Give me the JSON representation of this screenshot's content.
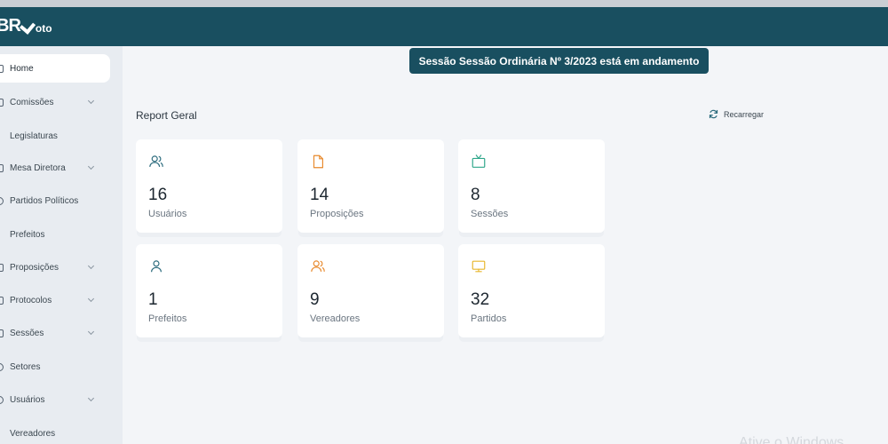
{
  "app": {
    "logo_main": "BR",
    "logo_suffix": "oto"
  },
  "banner": {
    "text": "Sessão Sessão Ordinária Nº 3/2023 está em andamento"
  },
  "sidebar": {
    "items": [
      {
        "label": "Home",
        "icon": "home-icon",
        "active": true,
        "expandable": false
      },
      {
        "label": "Comissões",
        "icon": "folder-icon",
        "active": false,
        "expandable": true
      },
      {
        "label": "Legislaturas",
        "icon": "",
        "active": false,
        "expandable": false
      },
      {
        "label": "Mesa Diretora",
        "icon": "table-icon",
        "active": false,
        "expandable": true
      },
      {
        "label": "Partidos Políticos",
        "icon": "flag-icon",
        "active": false,
        "expandable": false
      },
      {
        "label": "Prefeitos",
        "icon": "",
        "active": false,
        "expandable": false
      },
      {
        "label": "Proposições",
        "icon": "document-icon",
        "active": false,
        "expandable": true
      },
      {
        "label": "Protocolos",
        "icon": "clipboard-icon",
        "active": false,
        "expandable": true
      },
      {
        "label": "Sessões",
        "icon": "calendar-icon",
        "active": false,
        "expandable": true
      },
      {
        "label": "Setores",
        "icon": "grid-icon",
        "active": false,
        "expandable": false
      },
      {
        "label": "Usuários",
        "icon": "user-icon",
        "active": false,
        "expandable": true
      },
      {
        "label": "Vereadores",
        "icon": "",
        "active": false,
        "expandable": false
      }
    ]
  },
  "main": {
    "title": "Report Geral",
    "reload_label": "Recarregar",
    "cards": [
      {
        "value": "16",
        "label": "Usuários",
        "icon": "users-icon",
        "color": "#2a6a7c"
      },
      {
        "value": "14",
        "label": "Proposições",
        "icon": "document-icon",
        "color": "#e8892c"
      },
      {
        "value": "8",
        "label": "Sessões",
        "icon": "tv-icon",
        "color": "#2ea68a"
      },
      {
        "value": "1",
        "label": "Prefeitos",
        "icon": "user-icon",
        "color": "#2a6a7c"
      },
      {
        "value": "9",
        "label": "Vereadores",
        "icon": "users-icon",
        "color": "#e8892c"
      },
      {
        "value": "32",
        "label": "Partidos",
        "icon": "monitor-icon",
        "color": "#e8b62c"
      }
    ]
  },
  "colors": {
    "header": "#194f60",
    "sidebar": "#e8ecf1",
    "background": "#f3f5f8"
  },
  "watermark": "Ative o Windows"
}
